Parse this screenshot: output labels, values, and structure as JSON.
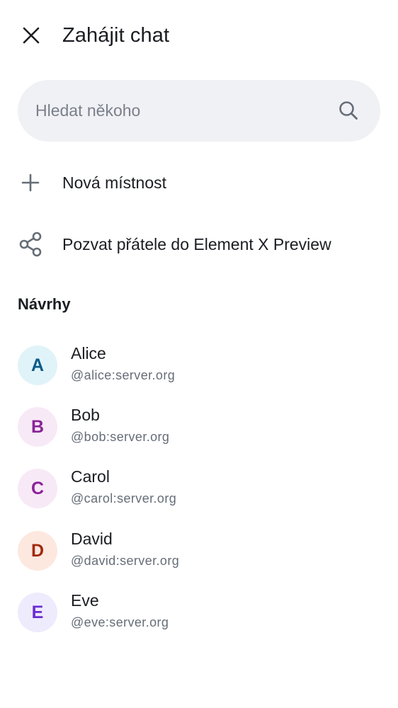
{
  "header": {
    "title": "Zahájit chat",
    "close_icon": "close-icon"
  },
  "search": {
    "placeholder": "Hledat někoho",
    "value": "",
    "icon": "search-icon"
  },
  "actions": [
    {
      "label": "Nová místnost",
      "icon": "plus-icon"
    },
    {
      "label": "Pozvat přátele do Element X Preview",
      "icon": "share-icon"
    }
  ],
  "suggestions": {
    "title": "Návrhy",
    "users": [
      {
        "initial": "A",
        "name": "Alice",
        "id": "@alice:server.org",
        "avatar_bg": "#e0f3f8",
        "avatar_fg": "#0a5a8a"
      },
      {
        "initial": "B",
        "name": "Bob",
        "id": "@bob:server.org",
        "avatar_bg": "#f8e9f7",
        "avatar_fg": "#8a2397"
      },
      {
        "initial": "C",
        "name": "Carol",
        "id": "@carol:server.org",
        "avatar_bg": "#f8e9f7",
        "avatar_fg": "#8a2397"
      },
      {
        "initial": "D",
        "name": "David",
        "id": "@david:server.org",
        "avatar_bg": "#fde8df",
        "avatar_fg": "#a2290b"
      },
      {
        "initial": "E",
        "name": "Eve",
        "id": "@eve:server.org",
        "avatar_bg": "#eeebfd",
        "avatar_fg": "#6b2cd0"
      }
    ]
  },
  "colors": {
    "text_primary": "#1b1d22",
    "text_secondary": "#656d77",
    "search_bg": "#f0f1f5",
    "icon": "#656d77"
  }
}
